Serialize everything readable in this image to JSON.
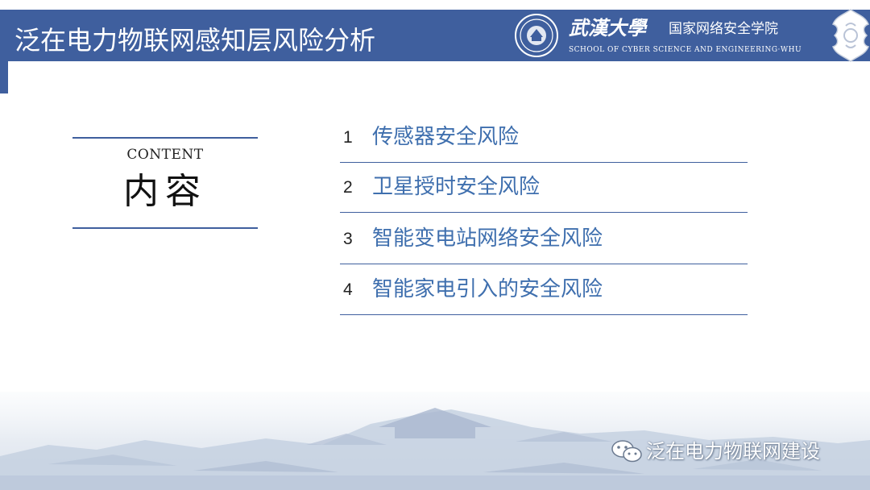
{
  "header": {
    "title": "泛在电力物联网感知层风险分析",
    "university_name": "武漢大學",
    "school_name_cn": "国家网络安全学院",
    "school_name_en": "SCHOOL OF CYBER SCIENCE AND ENGINEERING·WHU"
  },
  "contents": {
    "label_en": "CONTENT",
    "label_cn": "内容"
  },
  "agenda": [
    {
      "number": "1",
      "label": "传感器安全风险"
    },
    {
      "number": "2",
      "label": "卫星授时安全风险"
    },
    {
      "number": "3",
      "label": "智能变电站网络安全风险"
    },
    {
      "number": "4",
      "label": "智能家电引入的安全风险"
    }
  ],
  "watermark": {
    "text": "泛在电力物联网建设",
    "icon": "wechat-icon"
  },
  "colors": {
    "brand_blue": "#3f5f9e",
    "item_text": "#3f6fae",
    "scenery": "#c9d3e3"
  }
}
